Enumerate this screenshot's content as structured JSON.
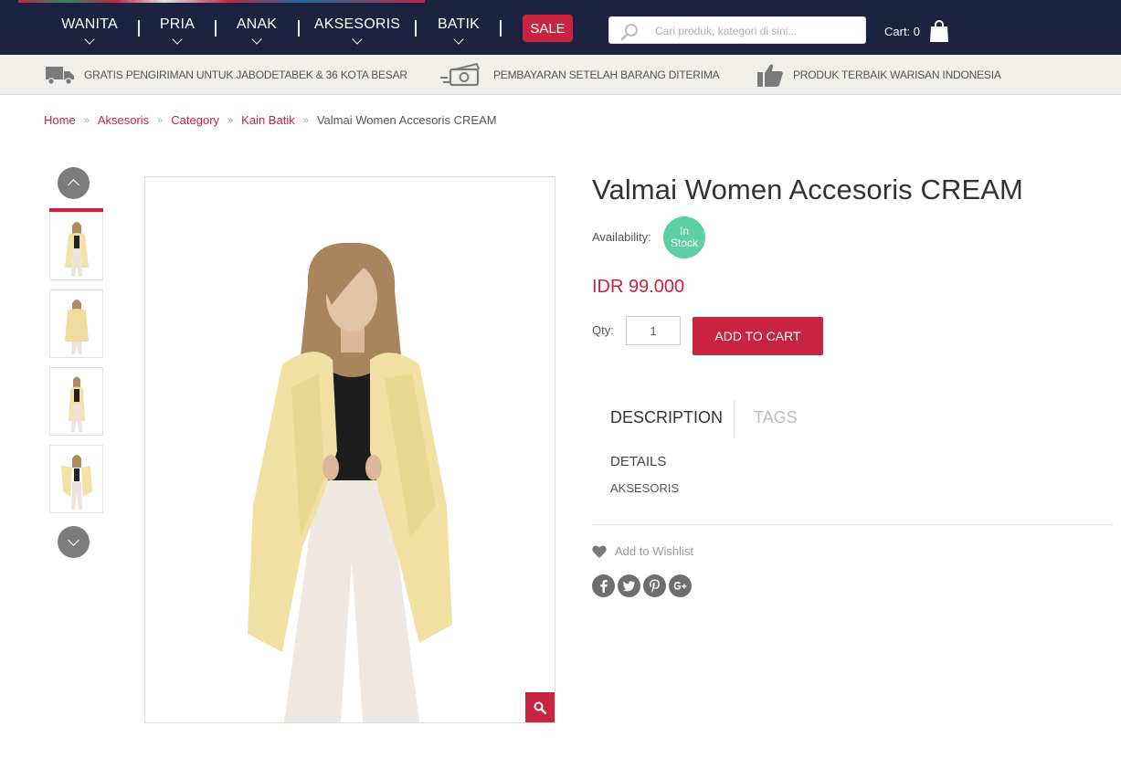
{
  "colors": {
    "navy": "#1b2340",
    "accent": "#c8233f",
    "stock": "#5ccfa5",
    "infobar": "#f1efea"
  },
  "nav": {
    "items": [
      {
        "label": "WANITA"
      },
      {
        "label": "PRIA"
      },
      {
        "label": "ANAK"
      },
      {
        "label": "AKSESORIS"
      },
      {
        "label": "BATIK"
      }
    ],
    "sale_label": "SALE",
    "search_placeholder": "Cari produk, kategori di sini...",
    "cart_label": "Cart: 0"
  },
  "infobar": {
    "items": [
      {
        "icon": "truck-icon",
        "text": "GRATIS PENGIRIMAN UNTUK JABODETABEK & 36 KOTA BESAR"
      },
      {
        "icon": "cash-icon",
        "text": "PEMBAYARAN SETELAH BARANG DITERIMA"
      },
      {
        "icon": "thumbs-up-icon",
        "text": "PRODUK TERBAIK WARISAN INDONESIA"
      }
    ]
  },
  "breadcrumb": {
    "items": [
      "Home",
      "Aksesoris",
      "Category",
      "Kain Batik"
    ],
    "separator": "»",
    "current": "Valmai Women Accesoris CREAM"
  },
  "product": {
    "title": "Valmai Women Accesoris CREAM",
    "availability_label": "Availability:",
    "stock_status": "In Stock",
    "price": "IDR 99.000",
    "qty_label": "Qty:",
    "qty_value": "1",
    "add_to_cart": "ADD TO CART",
    "tabs": [
      "DESCRIPTION",
      "TAGS"
    ],
    "details_heading": "DETAILS",
    "details_text": "AKSESORIS",
    "wishlist": "Add to Wishlist",
    "socials": [
      "facebook-icon",
      "twitter-icon",
      "pinterest-icon",
      "google-plus-icon"
    ]
  }
}
